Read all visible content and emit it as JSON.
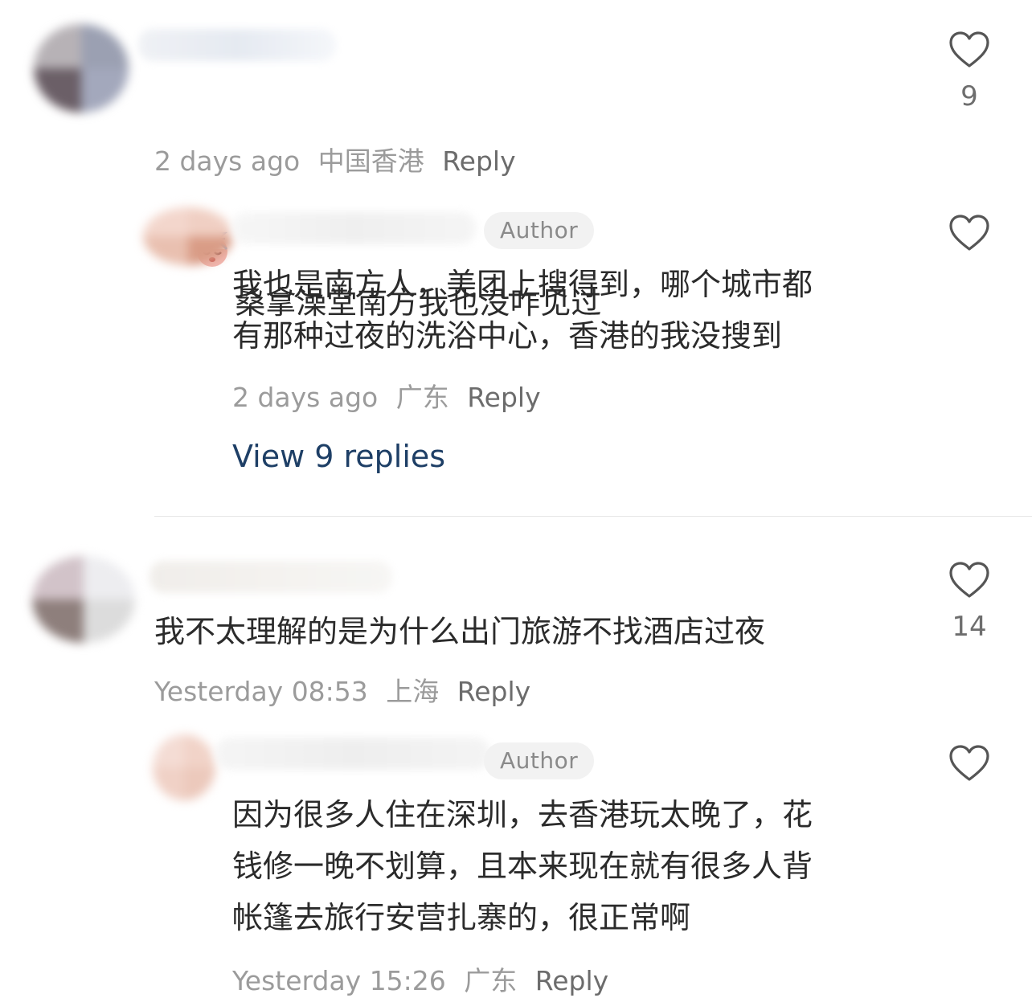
{
  "comments": [
    {
      "emoji": "sleepy-face-emoji",
      "text": "桑拿澡堂南方我也没咋见过",
      "time": "2 days ago",
      "location": "中国香港",
      "reply_label": "Reply",
      "likes": "9",
      "replies": [
        {
          "badge": "Author",
          "text": "我也是南方人，美团上搜得到，哪个城市都\n有那种过夜的洗浴中心，香港的我没搜到",
          "time": "2 days ago",
          "location": "广东",
          "reply_label": "Reply"
        }
      ],
      "view_replies": "View 9 replies"
    },
    {
      "text": "我不太理解的是为什么出门旅游不找酒店过夜",
      "time": "Yesterday 08:53",
      "location": "上海",
      "reply_label": "Reply",
      "likes": "14",
      "replies": [
        {
          "badge": "Author",
          "text": "因为很多人住在深圳，去香港玩太晚了，花\n钱修一晚不划算，且本来现在就有很多人背\n帐篷去旅行安营扎寨的，很正常啊",
          "time": "Yesterday 15:26",
          "location": "广东",
          "reply_label": "Reply"
        }
      ]
    }
  ],
  "colors": {
    "accent_link": "#1e3f66",
    "meta_text": "#9b9b9b",
    "badge_bg": "#f2f2f2"
  },
  "icons": {
    "like": "heart-outline-icon"
  }
}
